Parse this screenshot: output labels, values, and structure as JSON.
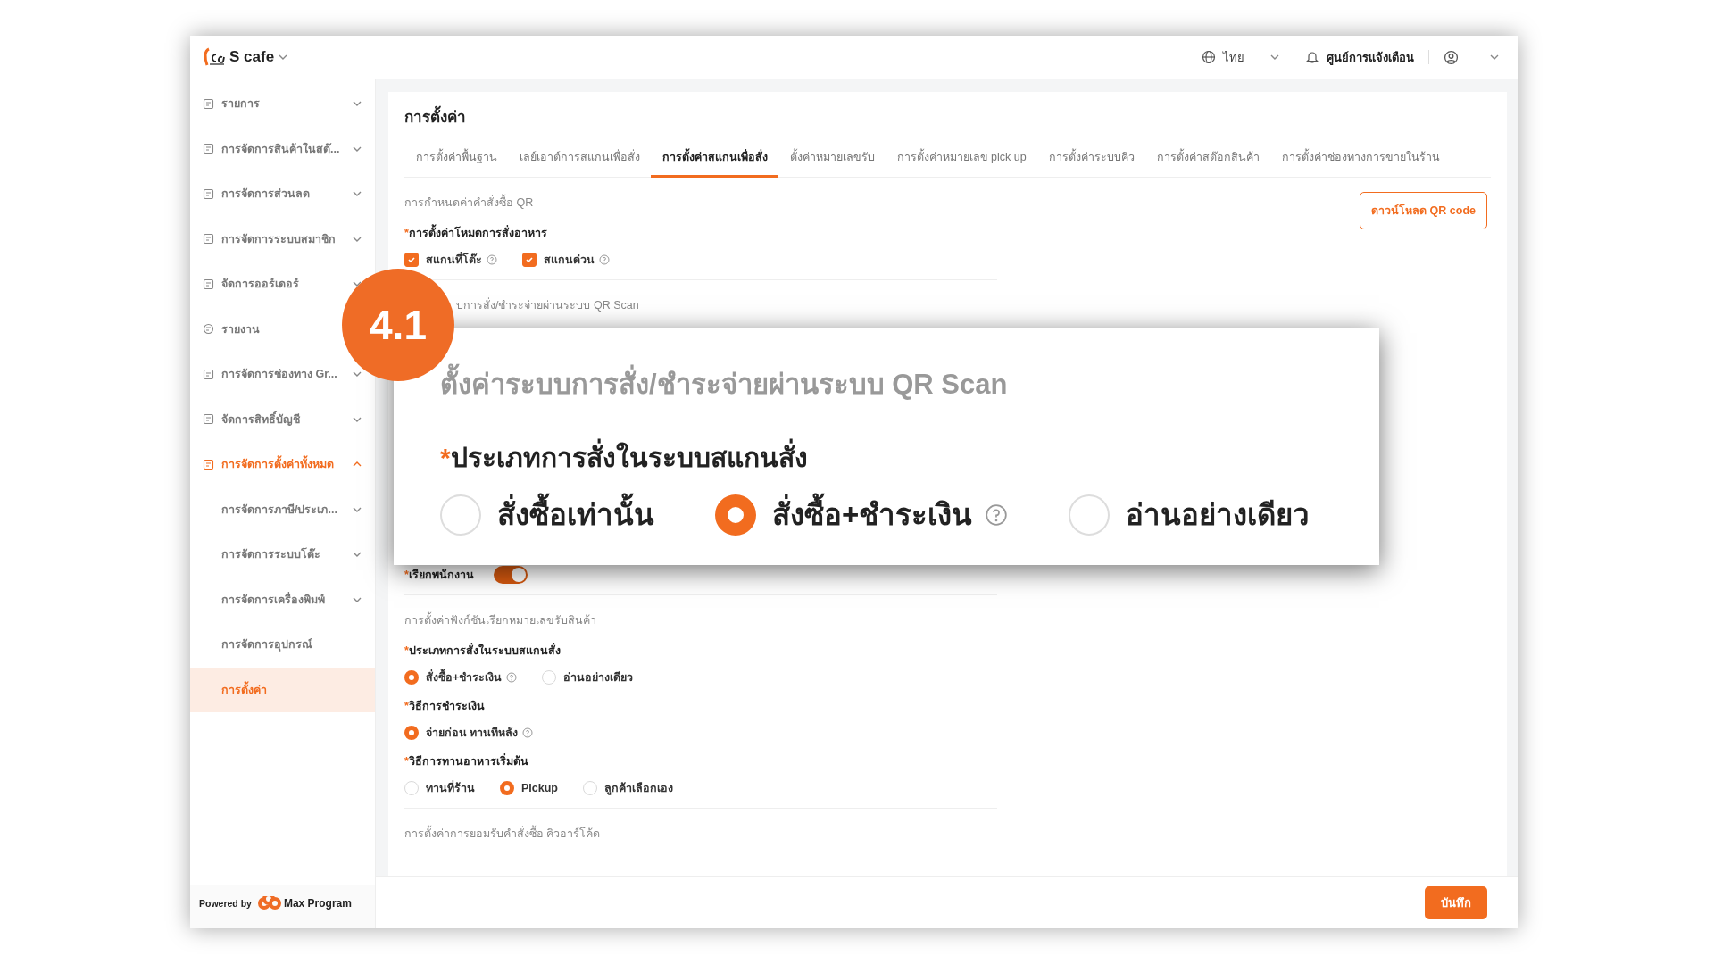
{
  "header": {
    "brand": "S cafe",
    "language": "ไทย",
    "notifications": "ศูนย์การแจ้งเตือน"
  },
  "sidebar": {
    "items": [
      {
        "label": "รายการ",
        "expanded": false,
        "selected": false
      },
      {
        "label": "การจัดการสินค้าในสต๊...",
        "expanded": false,
        "selected": false
      },
      {
        "label": "การจัดการส่วนลด",
        "expanded": false,
        "selected": false
      },
      {
        "label": "การจัดการระบบสมาชิก",
        "expanded": false,
        "selected": false
      },
      {
        "label": "จัดการออร์เดอร์",
        "expanded": false,
        "selected": false
      },
      {
        "label": "รายงาน",
        "selected": false
      },
      {
        "label": "การจัดการช่องทาง Gr...",
        "expanded": false,
        "selected": false
      },
      {
        "label": "จัดการสิทธิ์บัญชี",
        "expanded": false,
        "selected": false
      },
      {
        "label": "การจัดการตั้งค่าทั้งหมด",
        "expanded": true,
        "selected": false,
        "children": [
          {
            "label": "การจัดการภาษี/ประเภ...",
            "expanded": false,
            "selected": false
          },
          {
            "label": "การจัดการระบบโต๊ะ",
            "expanded": false,
            "selected": false
          },
          {
            "label": "การจัดการเครื่องพิมพ์",
            "expanded": false,
            "selected": false
          },
          {
            "label": "การจัดการอุปกรณ์",
            "selected": false
          },
          {
            "label": "การตั้งค่า",
            "selected": true
          }
        ]
      }
    ],
    "powered_by": "Powered by",
    "logo_text": "Max Program"
  },
  "page": {
    "title": "การตั้งค่า",
    "tabs": [
      {
        "label": "การตั้งค่าพื้นฐาน",
        "selected": false
      },
      {
        "label": "เลย์เอาต์การสแกนเพื่อสั่ง",
        "selected": false
      },
      {
        "label": "การตั้งค่าสแกนเพื่อสั่ง",
        "selected": true
      },
      {
        "label": "ตั้งค่าหมายเลขรับ",
        "selected": false
      },
      {
        "label": "การตั้งค่าหมายเลข pick up",
        "selected": false
      },
      {
        "label": "การตั้งค่าระบบคิว",
        "selected": false
      },
      {
        "label": "การตั้งค่าสต๊อกสินค้า",
        "selected": false
      },
      {
        "label": "การตั้งค่าช่องทางการขายในร้าน",
        "selected": false
      }
    ],
    "download_button": "ดาวน์โหลด QR code",
    "form": [
      {
        "kind": "section",
        "text": "การกำหนดค่าคำสั่งซื้อ QR"
      },
      {
        "kind": "checkboxes",
        "label": "การตั้งค่าโหมดการสั่งอาหาร",
        "required_mark": "*",
        "options": [
          {
            "label": "สแกนที่โต๊ะ",
            "checked": true,
            "help": true
          },
          {
            "label": "สแกนด่วน",
            "checked": true,
            "help": true
          }
        ]
      },
      {
        "kind": "divider"
      },
      {
        "kind": "partial_section",
        "text": "บการสั่ง/ชำระจ่ายผ่านระบบ QR Scan"
      },
      {
        "kind": "toggle",
        "label": "เรียกพนักงาน",
        "required_mark": "*",
        "on": true
      },
      {
        "kind": "divider"
      },
      {
        "kind": "section",
        "text": "การตั้งค่าฟังก์ชันเรียกหมายเลขรับสินค้า"
      },
      {
        "kind": "radios",
        "label": "ประเภทการสั่งในระบบสแกนสั่ง",
        "required_mark": "*",
        "options": [
          {
            "label": "สั่งซื้อ+ชำระเงิน",
            "selected": true,
            "help": true
          },
          {
            "label": "อ่านอย่างเดียว",
            "selected": false
          }
        ]
      },
      {
        "kind": "radios",
        "label": "วิธีการชำระเงิน",
        "required_mark": "*",
        "options": [
          {
            "label": "จ่ายก่อน ทานทีหลัง",
            "selected": true,
            "help": true
          }
        ]
      },
      {
        "kind": "radios",
        "label": "วิธีการทานอาหารเริ่มต้น",
        "required_mark": "*",
        "options": [
          {
            "label": "ทานที่ร้าน",
            "selected": false
          },
          {
            "label": "Pickup",
            "selected": true
          },
          {
            "label": "ลูกค้าเลือกเอง",
            "selected": false
          }
        ]
      },
      {
        "kind": "divider"
      },
      {
        "kind": "section",
        "text": "การตั้งค่าการยอมรับคำสั่งซื้อ คิวอาร์โค้ด"
      }
    ],
    "save_button": "บันทึก"
  },
  "callout": {
    "badge": "4.1",
    "title": "ตั้งค่าระบบการสั่ง/ชำระจ่ายผ่านระบบ QR Scan",
    "label": "ประเภทการสั่งในระบบสแกนสั่ง",
    "required_mark": "*",
    "options": [
      {
        "label": "สั่งซื้อเท่านั้น",
        "selected": false
      },
      {
        "label": "สั่งซื้อ+ชำระเงิน",
        "selected": true,
        "help": true
      },
      {
        "label": "อ่านอย่างเดียว",
        "selected": false
      }
    ]
  }
}
